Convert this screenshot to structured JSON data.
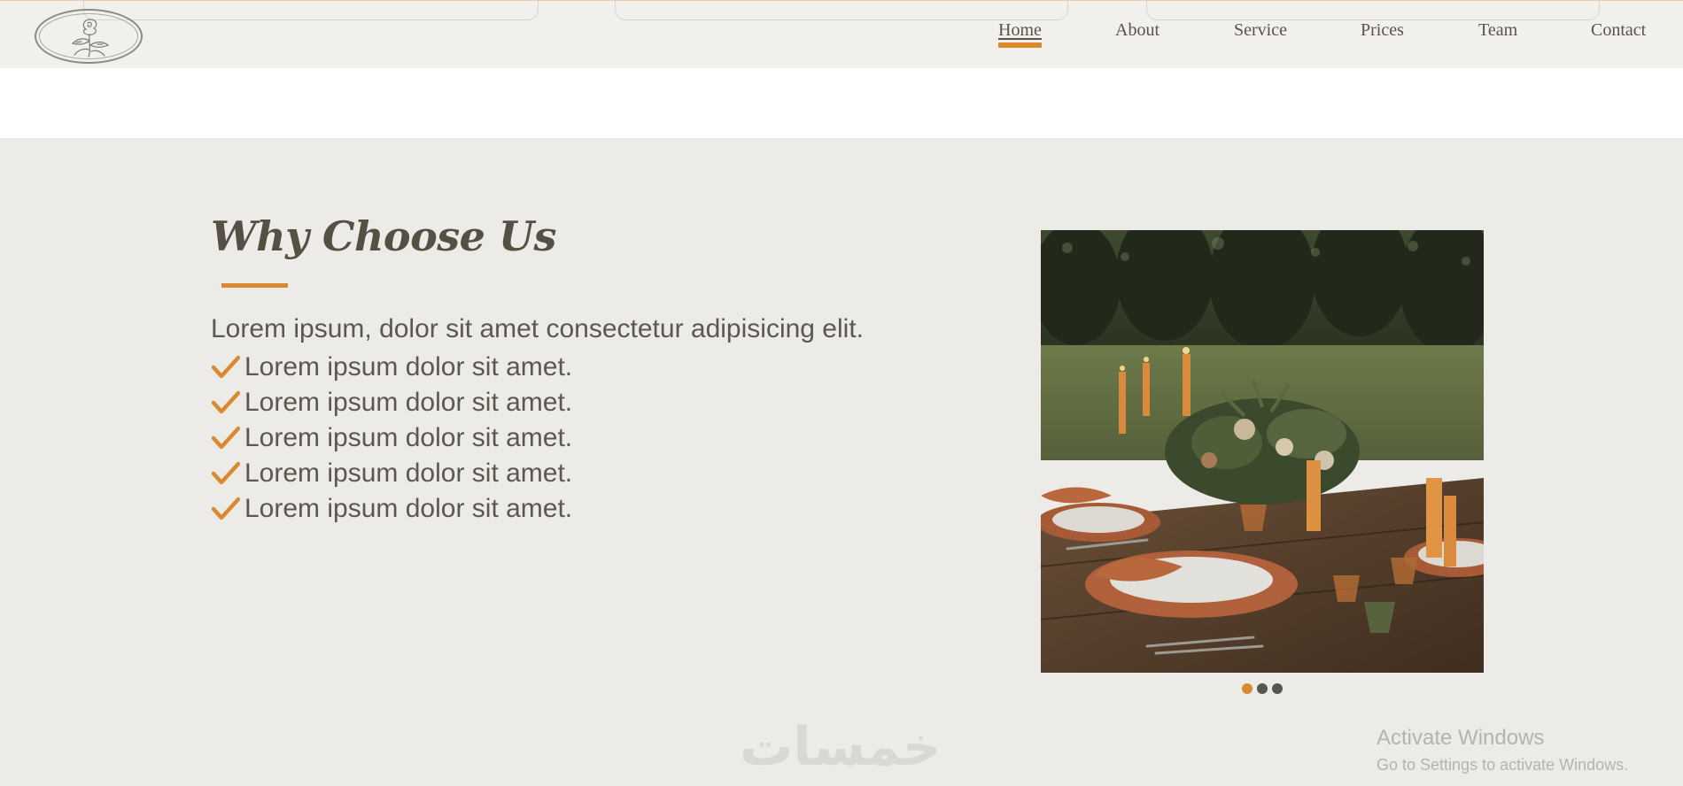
{
  "nav": {
    "items": [
      {
        "label": "Home",
        "active": true
      },
      {
        "label": "About",
        "active": false
      },
      {
        "label": "Service",
        "active": false
      },
      {
        "label": "Prices",
        "active": false
      },
      {
        "label": "Team",
        "active": false
      },
      {
        "label": "Contact",
        "active": false
      }
    ]
  },
  "logo": {
    "icon": "rose-icon"
  },
  "section": {
    "title": "Why Choose Us",
    "intro": "Lorem ipsum, dolor sit amet consectetur adipisicing elit.",
    "checklist": [
      "Lorem ipsum dolor sit amet.",
      "Lorem ipsum dolor sit amet.",
      "Lorem ipsum dolor sit amet.",
      "Lorem ipsum dolor sit amet.",
      "Lorem ipsum dolor sit amet."
    ],
    "check_icon": "checkmark-icon"
  },
  "carousel": {
    "slide_count": 3,
    "active_slide": 1
  },
  "watermarks": {
    "site_logo": "خمسات",
    "activate_title": "Activate Windows",
    "activate_subtitle": "Go to Settings to activate Windows."
  },
  "colors": {
    "accent": "#d98a2f",
    "text": "#5c584f",
    "background": "#ecebe7",
    "header_bg": "#f1f0ec"
  }
}
